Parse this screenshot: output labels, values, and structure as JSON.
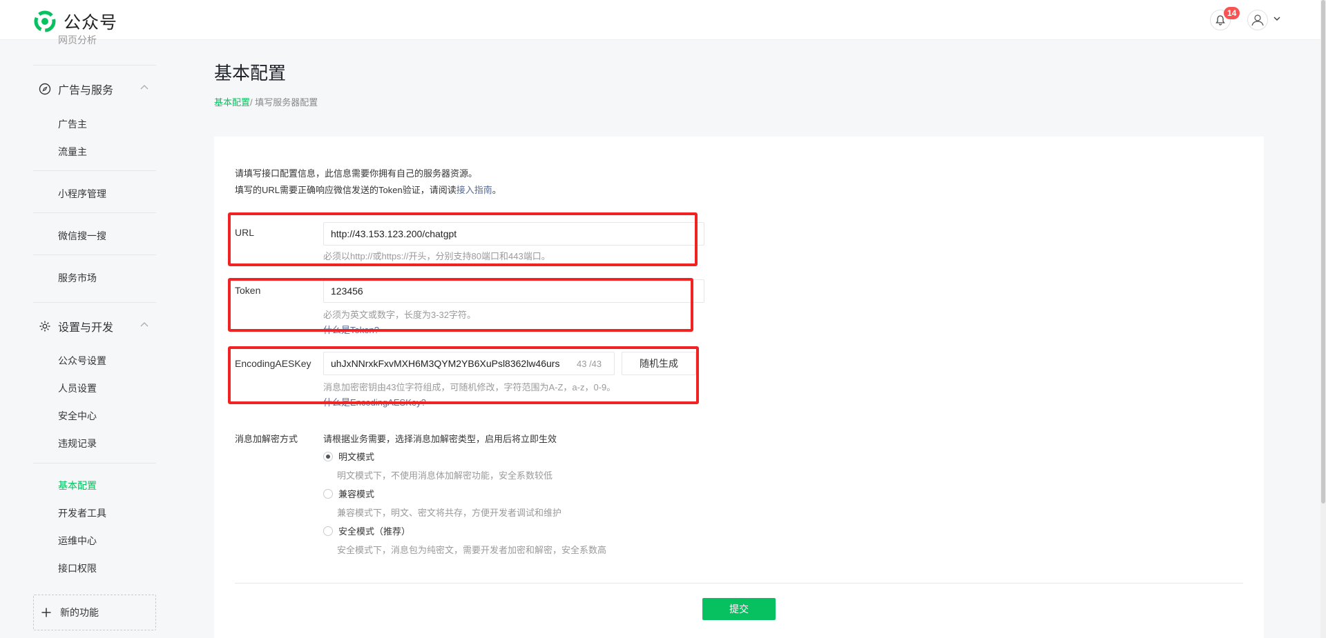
{
  "app": {
    "name": "公众号"
  },
  "header": {
    "notification_count": "14"
  },
  "sidebar": {
    "partial_item": "网页分析",
    "sections": [
      {
        "title": "广告与服务",
        "icon": "compass-icon",
        "items": [
          "广告主",
          "流量主"
        ]
      },
      {
        "standalone": [
          "小程序管理",
          "微信搜一搜",
          "服务市场"
        ]
      },
      {
        "title": "设置与开发",
        "icon": "gear-icon",
        "items": [
          "公众号设置",
          "人员设置",
          "安全中心",
          "违规记录"
        ]
      },
      {
        "dev_items": [
          "基本配置",
          "开发者工具",
          "运维中心",
          "接口权限"
        ]
      }
    ],
    "new_feature": "新的功能",
    "active_item": "基本配置"
  },
  "page": {
    "title": "基本配置",
    "breadcrumb": {
      "current": "基本配置",
      "sep": "/ ",
      "next": "填写服务器配置"
    }
  },
  "form": {
    "intro_line1": "请填写接口配置信息，此信息需要你拥有自己的服务器资源。",
    "intro_line2_pre": "填写的URL需要正确响应微信发送的Token验证，请阅读",
    "intro_link": "接入指南",
    "intro_line2_post": "。",
    "url": {
      "label": "URL",
      "value": "http://43.153.123.200/chatgpt",
      "hint": "必须以http://或https://开头，分别支持80端口和443端口。"
    },
    "token": {
      "label": "Token",
      "value": "123456",
      "hint": "必须为英文或数字，长度为3-32字符。",
      "help_link": "什么是Token?"
    },
    "aes": {
      "label": "EncodingAESKey",
      "value": "uhJxNNrxkFxvMXH6M3QYM2YB6XuPsl8362lw46urs",
      "counter": "43 /43",
      "random_button": "随机生成",
      "hint": "消息加密密钥由43位字符组成，可随机修改，字符范围为A-Z，a-z，0-9。",
      "help_link": "什么是EncodingAESKey?"
    },
    "encryption": {
      "label": "消息加解密方式",
      "description": "请根据业务需要，选择消息加解密类型，启用后将立即生效",
      "options": [
        {
          "label": "明文模式",
          "desc": "明文模式下，不使用消息体加解密功能，安全系数较低",
          "checked": true
        },
        {
          "label": "兼容模式",
          "desc": "兼容模式下，明文、密文将共存，方便开发者调试和维护",
          "checked": false
        },
        {
          "label": "安全模式（推荐）",
          "desc": "安全模式下，消息包为纯密文，需要开发者加密和解密，安全系数高",
          "checked": false
        }
      ]
    },
    "submit_label": "提交"
  },
  "colors": {
    "accent": "#07c160",
    "highlight": "#f02323",
    "link": "#576b95"
  }
}
